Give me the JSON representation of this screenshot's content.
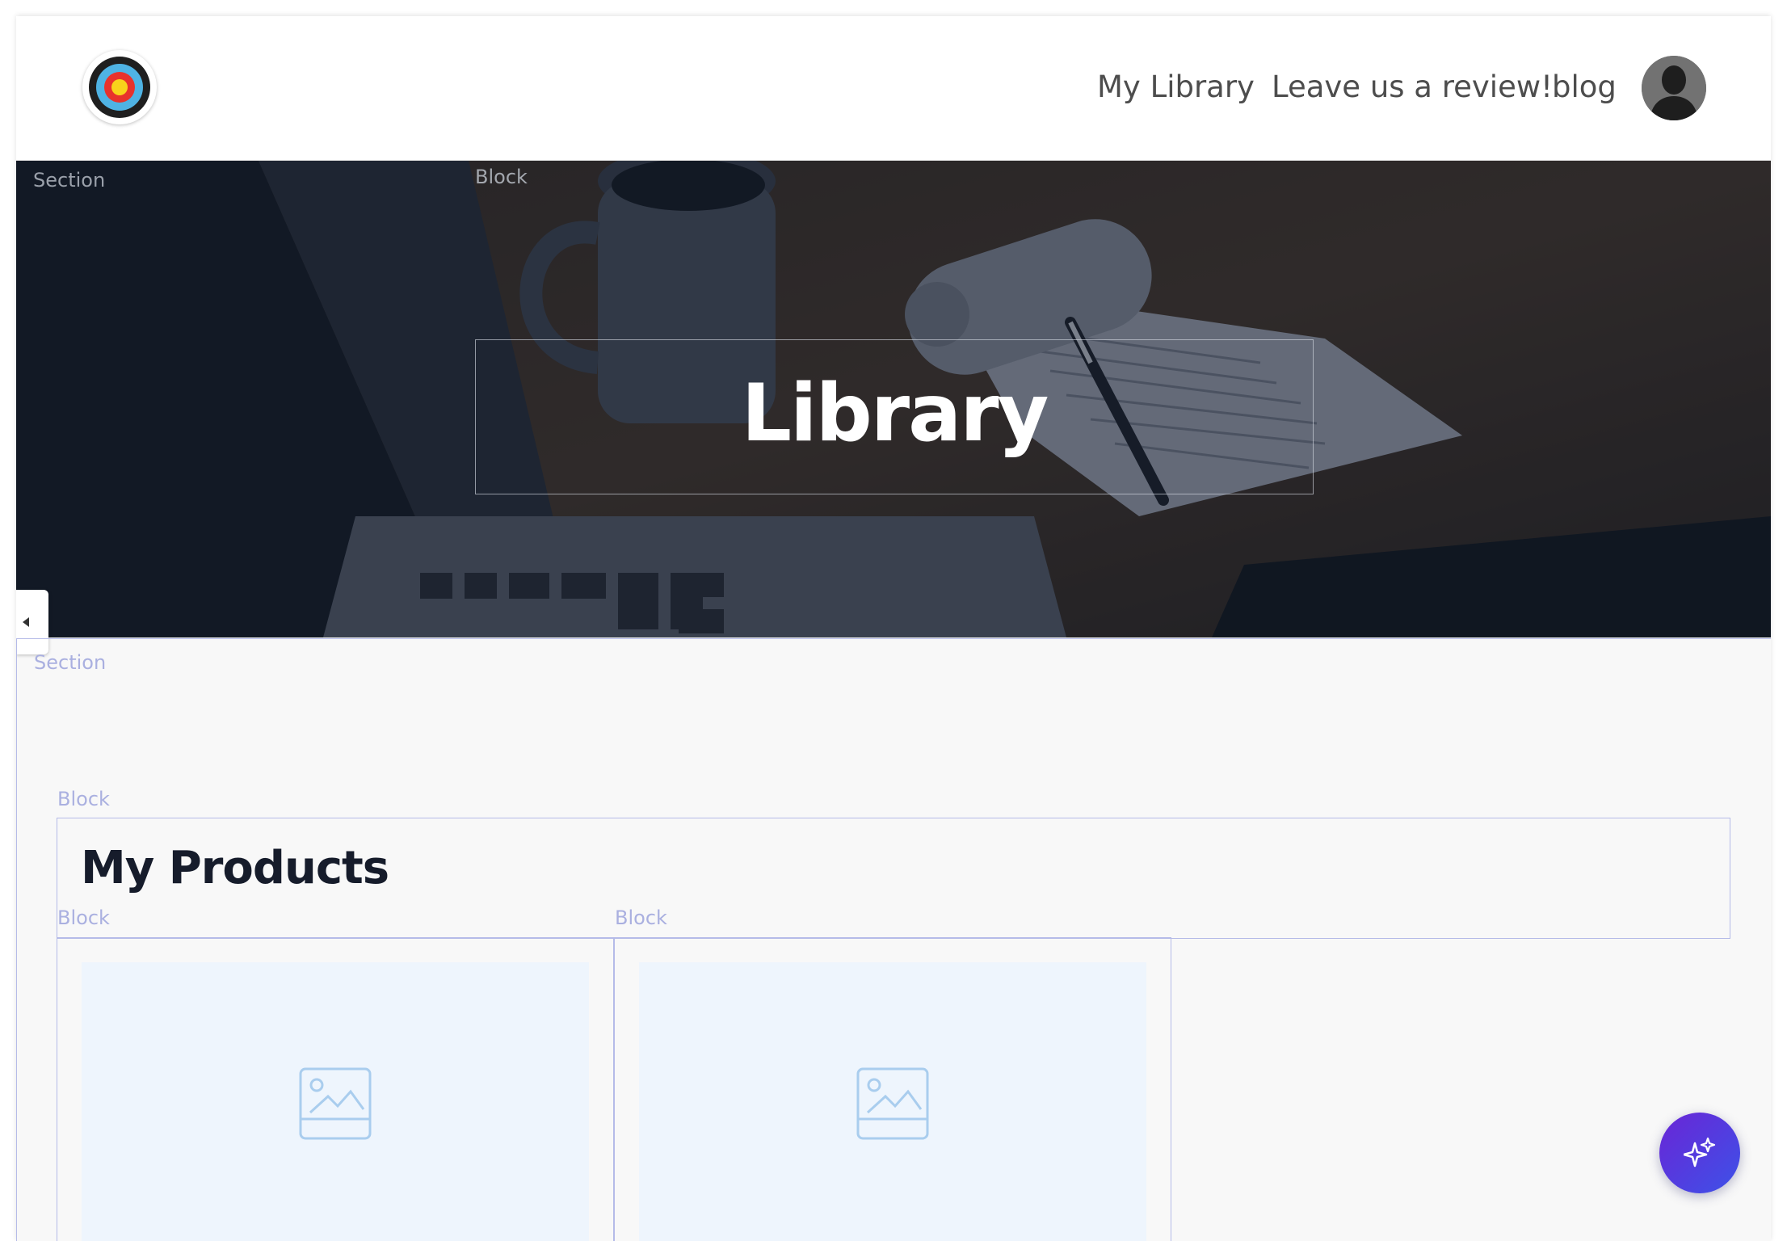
{
  "header": {
    "logo_name": "target-logo",
    "nav": {
      "my_library": "My Library",
      "review": "Leave us a review!",
      "blog": "blog"
    },
    "avatar_name": "user-avatar"
  },
  "hero": {
    "section_label": "Section",
    "block_label": "Block",
    "title": "Library"
  },
  "content": {
    "section_label": "Section",
    "products_block_label": "Block",
    "products_title": "My Products",
    "cards": [
      {
        "block_label": "Block",
        "image_icon": "image-placeholder-icon"
      },
      {
        "block_label": "Block",
        "image_icon": "image-placeholder-icon"
      }
    ]
  },
  "fab": {
    "icon": "sparkle-icon"
  },
  "colors": {
    "accent_gradient_start": "#6a25d6",
    "accent_gradient_end": "#3d52e8",
    "editor_outline": "#b5bbe8",
    "heading": "#161c2b",
    "image_placeholder_bg": "#eef5fd"
  }
}
